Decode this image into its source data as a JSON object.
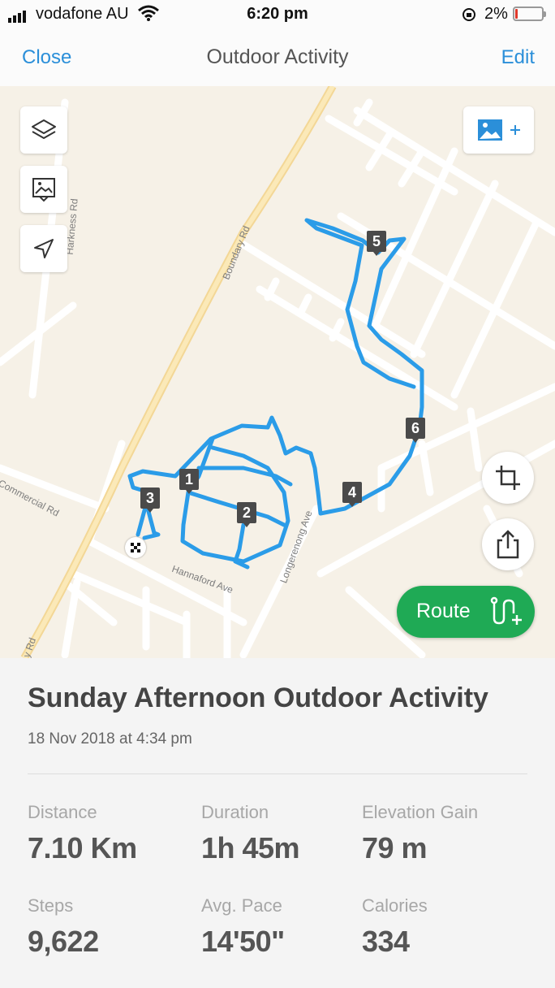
{
  "status_bar": {
    "carrier": "vodafone AU",
    "time": "6:20 pm",
    "battery_percent": "2%"
  },
  "nav": {
    "close_label": "Close",
    "title": "Outdoor Activity",
    "edit_label": "Edit"
  },
  "map": {
    "roads": {
      "boundary": "Boundary Rd",
      "harkness": "Harkness Rd",
      "commercial": "Commercial Rd",
      "hannaford": "Hannaford Ave",
      "longerenong": "Longerenong Ave",
      "bottom_rd": "y Rd"
    },
    "markers": [
      "1",
      "2",
      "3",
      "4",
      "5",
      "6"
    ],
    "buttons": {
      "layers": "layers-icon",
      "photos": "photo-frame-icon",
      "locate": "location-arrow-icon",
      "add_photo": "add-photo-icon",
      "crop": "crop-icon",
      "share": "share-icon"
    },
    "route_label": "Route",
    "route_color": "#2b9ce8",
    "route_button_color": "#1faa55"
  },
  "activity": {
    "title": "Sunday Afternoon Outdoor Activity",
    "date": "18 Nov 2018 at 4:34 pm",
    "stats": [
      {
        "label": "Distance",
        "value": "7.10 Km"
      },
      {
        "label": "Duration",
        "value": "1h 45m"
      },
      {
        "label": "Elevation Gain",
        "value": "79 m"
      },
      {
        "label": "Steps",
        "value": "9,622"
      },
      {
        "label": "Avg. Pace",
        "value": "14'50\""
      },
      {
        "label": "Calories",
        "value": "334"
      }
    ]
  }
}
